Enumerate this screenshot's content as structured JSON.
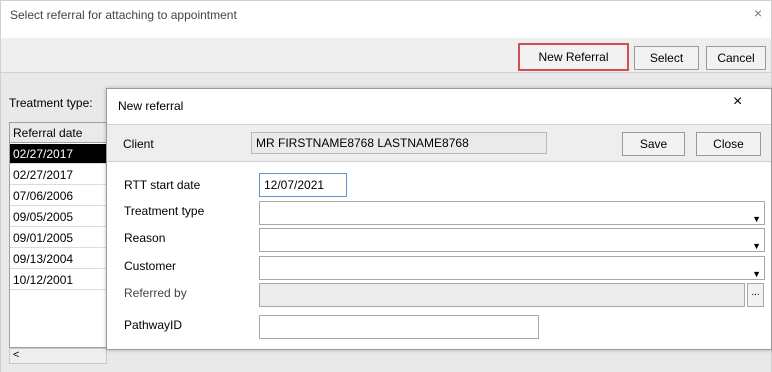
{
  "outer_dialog": {
    "title": "Select referral for attaching to appointment",
    "close_glyph": "×",
    "buttons": {
      "new_referral": "New Referral",
      "select": "Select",
      "cancel": "Cancel"
    },
    "treatment_type_label": "Treatment type:",
    "table": {
      "header": "Referral date",
      "rows": [
        "02/27/2017",
        "02/27/2017",
        "07/06/2006",
        "09/05/2005",
        "09/01/2005",
        "09/13/2004",
        "10/12/2001"
      ]
    },
    "scroll_left_glyph": "<"
  },
  "inner_dialog": {
    "title": "New referral",
    "close_glyph": "×",
    "client_label": "Client",
    "client_value": "MR FIRSTNAME8768 LASTNAME8768",
    "save": "Save",
    "close": "Close",
    "fields": {
      "rtt_start_date": {
        "label": "RTT start date",
        "value": "12/07/2021"
      },
      "treatment_type": {
        "label": "Treatment type",
        "value": ""
      },
      "reason": {
        "label": "Reason",
        "value": ""
      },
      "customer": {
        "label": "Customer",
        "value": ""
      },
      "referred_by": {
        "label": "Referred by",
        "value": ""
      },
      "pathway_id": {
        "label": "PathwayID",
        "value": ""
      }
    },
    "dropdown_glyph": "▼",
    "ellipsis_glyph": "..."
  }
}
